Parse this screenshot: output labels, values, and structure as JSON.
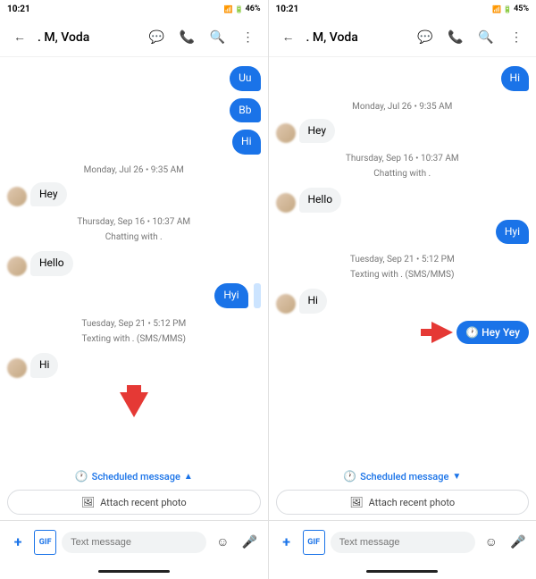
{
  "left_screen": {
    "status_bar": {
      "time": "10:21",
      "battery": "46%"
    },
    "app_bar": {
      "back_label": "←",
      "title": ". M, Voda",
      "icons": [
        "message-icon",
        "phone-icon",
        "search-icon",
        "more-icon"
      ]
    },
    "messages": [
      {
        "type": "sent",
        "text": "Uu",
        "avatar": false
      },
      {
        "type": "sent",
        "text": "Bb",
        "avatar": false
      },
      {
        "type": "sent",
        "text": "Hi",
        "avatar": false
      },
      {
        "type": "date",
        "text": "Monday, Jul 26 • 9:35 AM"
      },
      {
        "type": "received",
        "text": "Hey",
        "avatar": true
      },
      {
        "type": "date",
        "text": "Thursday, Sep 16 • 10:37 AM"
      },
      {
        "type": "sub",
        "text": "Chatting with ."
      },
      {
        "type": "received",
        "text": "Hello",
        "avatar": true
      },
      {
        "type": "sent",
        "text": "Hyi",
        "avatar": false
      },
      {
        "type": "date",
        "text": "Tuesday, Sep 21 • 5:12 PM"
      },
      {
        "type": "sub",
        "text": "Texting with . (SMS/MMS)"
      },
      {
        "type": "received",
        "text": "Hi",
        "avatar": true
      }
    ],
    "scheduled_bar": {
      "icon": "clock-icon",
      "label": "Scheduled message",
      "chevron": "▲"
    },
    "attach_btn": {
      "icon": "image-icon",
      "label": "Attach recent photo"
    },
    "input": {
      "placeholder": "Text message"
    },
    "bottom_icons": [
      "add-icon",
      "gif-icon",
      "emoji-icon",
      "mic-icon"
    ]
  },
  "right_screen": {
    "status_bar": {
      "time": "10:21",
      "battery": "45%"
    },
    "app_bar": {
      "back_label": "←",
      "title": ". M, Voda",
      "icons": [
        "message-icon",
        "phone-icon",
        "search-icon",
        "more-icon"
      ]
    },
    "messages": [
      {
        "type": "sent",
        "text": "Hi",
        "avatar": false
      },
      {
        "type": "date",
        "text": "Monday, Jul 26 • 9:35 AM"
      },
      {
        "type": "received",
        "text": "Hey",
        "avatar": true
      },
      {
        "type": "date",
        "text": "Thursday, Sep 16 • 10:37 AM"
      },
      {
        "type": "sub",
        "text": "Chatting with ."
      },
      {
        "type": "received",
        "text": "Hello",
        "avatar": true
      },
      {
        "type": "sent",
        "text": "Hyi",
        "avatar": false
      },
      {
        "type": "date",
        "text": "Tuesday, Sep 21 • 5:12 PM"
      },
      {
        "type": "sub",
        "text": "Texting with . (SMS/MMS)"
      },
      {
        "type": "received",
        "text": "Hi",
        "avatar": true
      },
      {
        "type": "scheduled_bubble",
        "text": "Hey Yey"
      }
    ],
    "scheduled_bar": {
      "icon": "clock-icon",
      "label": "Scheduled message",
      "chevron": "▼"
    },
    "attach_btn": {
      "icon": "image-icon",
      "label": "Attach recent photo"
    },
    "input": {
      "placeholder": "Text message"
    },
    "bottom_icons": [
      "add-icon",
      "gif-icon",
      "emoji-icon",
      "mic-icon"
    ]
  },
  "icons": {
    "back": "←",
    "message": "💬",
    "phone": "📞",
    "search": "🔍",
    "more": "⋮",
    "add": "+",
    "gif": "GIF",
    "emoji": "☺",
    "mic": "🎤",
    "clock": "🕐",
    "image": "🖼",
    "chevron_up": "▲",
    "chevron_down": "▼"
  }
}
